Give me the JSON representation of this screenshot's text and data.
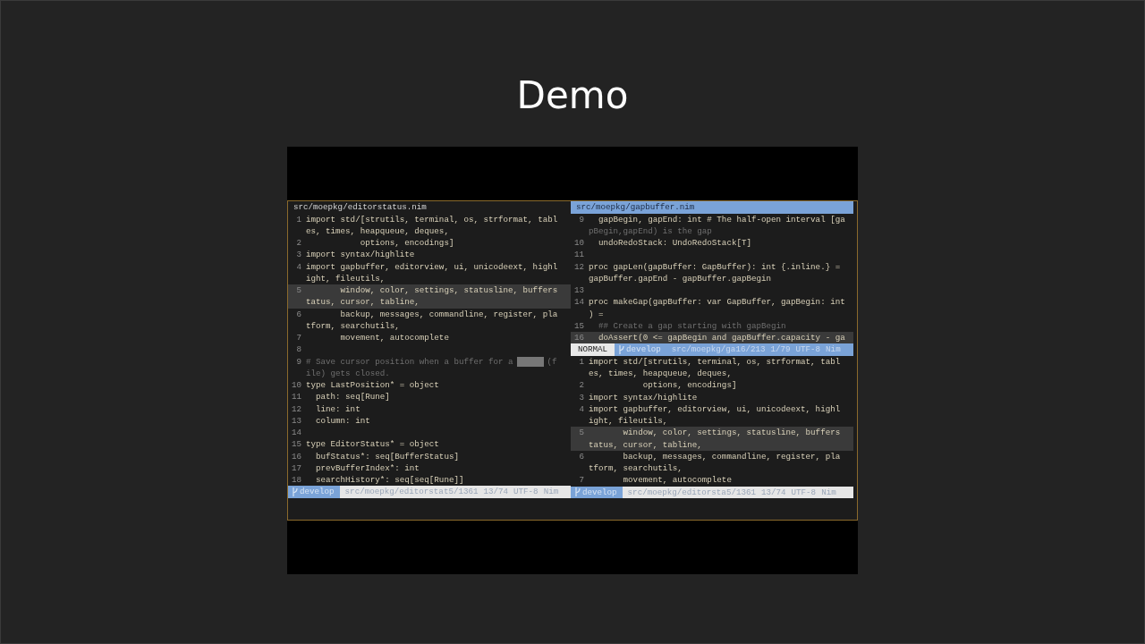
{
  "slide": {
    "title": "Demo"
  },
  "panes": [
    {
      "title": "src/moepkg/editorstatus.nim",
      "active": false,
      "sections": [
        {
          "rows": [
            {
              "num": "1",
              "text": "import std/[strutils, terminal, os, strformat, tabl",
              "kind": "code",
              "highlighted": false
            },
            {
              "num": "",
              "text": "es, times, heapqueue, deques,",
              "kind": "code",
              "highlighted": false
            },
            {
              "num": "2",
              "text": "           options, encodings]",
              "kind": "code",
              "highlighted": false
            },
            {
              "num": "3",
              "text": "import syntax/highlite",
              "kind": "code",
              "highlighted": false
            },
            {
              "num": "4",
              "text": "import gapbuffer, editorview, ui, unicodeext, highl",
              "kind": "code",
              "highlighted": false
            },
            {
              "num": "",
              "text": "ight, fileutils,",
              "kind": "code",
              "highlighted": false
            },
            {
              "num": "5",
              "text": "       window, color, settings, statusline, buffers",
              "kind": "code",
              "highlighted": true
            },
            {
              "num": "",
              "text": "tatus, cursor, tabline,",
              "kind": "code",
              "highlighted": true
            },
            {
              "num": "6",
              "text": "       backup, messages, commandline, register, pla",
              "kind": "code",
              "highlighted": false
            },
            {
              "num": "",
              "text": "tform, searchutils,",
              "kind": "code",
              "highlighted": false
            },
            {
              "num": "7",
              "text": "       movement, autocomplete",
              "kind": "code",
              "highlighted": false
            },
            {
              "num": "8",
              "text": "",
              "kind": "code",
              "highlighted": false
            },
            {
              "num": "9",
              "text": "# Save cursor position when a buffer for a",
              "tail": "(f",
              "masked": true,
              "kind": "comment",
              "highlighted": false
            },
            {
              "num": "",
              "text": "ile) gets closed.",
              "kind": "comment",
              "highlighted": false
            },
            {
              "num": "10",
              "text": "type LastPosition* = object",
              "kind": "code",
              "highlighted": false
            },
            {
              "num": "11",
              "text": "  path: seq[Rune]",
              "kind": "code",
              "highlighted": false
            },
            {
              "num": "12",
              "text": "  line: int",
              "kind": "code",
              "highlighted": false
            },
            {
              "num": "13",
              "text": "  column: int",
              "kind": "code",
              "highlighted": false
            },
            {
              "num": "14",
              "text": "",
              "kind": "code",
              "highlighted": false
            },
            {
              "num": "15",
              "text": "type EditorStatus* = object",
              "kind": "code",
              "highlighted": false
            },
            {
              "num": "16",
              "text": "  bufStatus*: seq[BufferStatus]",
              "kind": "code",
              "highlighted": false
            },
            {
              "num": "17",
              "text": "  prevBufferIndex*: int",
              "kind": "code",
              "highlighted": false
            },
            {
              "num": "18",
              "text": "  searchHistory*: seq[seq[Rune]]",
              "kind": "code",
              "highlighted": false
            }
          ],
          "status": {
            "branch": "develop",
            "file": "src/moepkg/editorstat5/1361",
            "position": "13/74",
            "encoding": "UTF-8",
            "filetype": "Nim"
          }
        }
      ]
    },
    {
      "title": "src/moepkg/gapbuffer.nim",
      "active": true,
      "sections": [
        {
          "rows": [
            {
              "num": "9",
              "text": "  gapBegin, gapEnd: int # The half-open interval [ga",
              "kind": "code",
              "highlighted": false
            },
            {
              "num": "",
              "text": "pBegin,gapEnd) is the gap",
              "kind": "comment",
              "highlighted": false
            },
            {
              "num": "10",
              "text": "  undoRedoStack: UndoRedoStack[T]",
              "kind": "code",
              "highlighted": false
            },
            {
              "num": "11",
              "text": "",
              "kind": "code",
              "highlighted": false
            },
            {
              "num": "12",
              "text": "proc gapLen(gapBuffer: GapBuffer): int {.inline.} =",
              "kind": "code",
              "highlighted": false
            },
            {
              "num": "",
              "text": "gapBuffer.gapEnd - gapBuffer.gapBegin",
              "kind": "code",
              "highlighted": false
            },
            {
              "num": "13",
              "text": "",
              "kind": "code",
              "highlighted": false
            },
            {
              "num": "14",
              "text": "proc makeGap(gapBuffer: var GapBuffer, gapBegin: int",
              "kind": "code",
              "highlighted": false
            },
            {
              "num": "",
              "text": ") =",
              "kind": "code",
              "highlighted": false
            },
            {
              "num": "15",
              "text": "  ## Create a gap starting with gapBegin",
              "kind": "comment",
              "highlighted": false
            },
            {
              "num": "16",
              "text": "  doAssert(0 <= gapBegin and gapBuffer.capacity - ga",
              "kind": "code",
              "highlighted": true
            }
          ],
          "status": {
            "mode": "NORMAL",
            "branch": "develop",
            "file": "src/moepkg/ga16/213",
            "position": "1/79",
            "encoding": "UTF-8",
            "filetype": "Nim"
          }
        },
        {
          "rows": [
            {
              "num": "1",
              "text": "import std/[strutils, terminal, os, strformat, tabl",
              "kind": "code",
              "highlighted": false
            },
            {
              "num": "",
              "text": "es, times, heapqueue, deques,",
              "kind": "code",
              "highlighted": false
            },
            {
              "num": "2",
              "text": "           options, encodings]",
              "kind": "code",
              "highlighted": false
            },
            {
              "num": "3",
              "text": "import syntax/highlite",
              "kind": "code",
              "highlighted": false
            },
            {
              "num": "4",
              "text": "import gapbuffer, editorview, ui, unicodeext, highl",
              "kind": "code",
              "highlighted": false
            },
            {
              "num": "",
              "text": "ight, fileutils,",
              "kind": "code",
              "highlighted": false
            },
            {
              "num": "5",
              "text": "       window, color, settings, statusline, buffers",
              "kind": "code",
              "highlighted": true
            },
            {
              "num": "",
              "text": "tatus, cursor, tabline,",
              "kind": "code",
              "highlighted": true
            },
            {
              "num": "6",
              "text": "       backup, messages, commandline, register, pla",
              "kind": "code",
              "highlighted": false
            },
            {
              "num": "",
              "text": "tform, searchutils,",
              "kind": "code",
              "highlighted": false
            },
            {
              "num": "7",
              "text": "       movement, autocomplete",
              "kind": "code",
              "highlighted": false
            }
          ],
          "status": {
            "branch": "develop",
            "file": "src/moepkg/editorsta5/1361",
            "position": "13/74",
            "encoding": "UTF-8",
            "filetype": "Nim"
          }
        }
      ]
    }
  ]
}
